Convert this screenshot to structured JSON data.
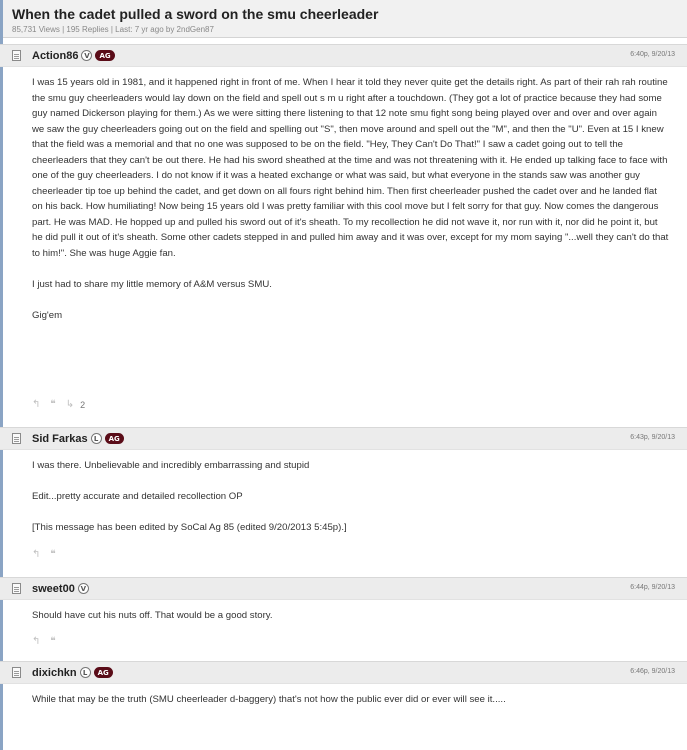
{
  "thread": {
    "title": "When the cadet pulled a sword on the smu cheerleader",
    "meta": "85,731 Views | 195 Replies | Last: 7 yr ago by 2ndGen87"
  },
  "icons": {
    "post": "document-icon",
    "reply": "reply-icon",
    "quote": "quote-icon",
    "like": "like-icon",
    "reply_glyph": "↰",
    "quote_glyph": "❝",
    "like_glyph": "↳"
  },
  "colors": {
    "ag_badge": "#5a0c18",
    "header_bg": "#ececec"
  },
  "posts": [
    {
      "username": "Action86",
      "badge_letter": "V",
      "badge_ag": "AG",
      "time": "6:40p, 9/20/13",
      "paragraphs": [
        "I was 15 years old in 1981, and it happened right in front of me. When I hear it told they never quite get the details right. As part of their rah rah routine the smu guy cheerleaders would lay down on the field and spell out s m u right after a touchdown. (They got a lot of practice because they had some guy named Dickerson playing for them.) As we were sitting there listening to that 12 note smu fight song being played over and over and over again we saw the guy cheerleaders going out on the field and spelling out \"S\", then move around and spell out the \"M\", and then the \"U\". Even at 15 I knew that the field was a memorial and that no one was supposed to be on the field. \"Hey, They Can't Do That!\" I saw a cadet going out to tell the cheerleaders that they can't be out there. He had his sword sheathed at the time and was not threatening with it. He ended up talking face to face with one of the guy cheerleaders. I do not know if it was a heated exchange or what was said, but what everyone in the stands saw was another guy cheerleader tip toe up behind the cadet, and get down on all fours right behind him. Then first cheerleader pushed the cadet over and he landed flat on his back. How humiliating! Now being 15 years old I was pretty familiar with this cool move but I felt sorry for that guy. Now comes the dangerous part. He was MAD. He hopped up and pulled his sword out of it's sheath. To my recollection he did not wave it, nor run with it, nor did he point it, but he did pull it out of it's sheath. Some other cadets stepped in and pulled him away and it was over, except for my mom saying \"...well they can't do that to him!\". She was huge Aggie fan.",
        "I just had to share my little memory of A&M versus SMU.",
        "Gig'em"
      ],
      "like_count": "2"
    },
    {
      "username": "Sid Farkas",
      "badge_letter": "L",
      "badge_ag": "AG",
      "time": "6:43p, 9/20/13",
      "paragraphs": [
        "I was there. Unbelievable and incredibly embarrassing and stupid",
        "Edit...pretty accurate and detailed recollection OP",
        "[This message has been edited by SoCal Ag 85 (edited 9/20/2013 5:45p).]"
      ]
    },
    {
      "username": "sweet00",
      "badge_letter": "V",
      "time": "6:44p, 9/20/13",
      "paragraphs": [
        "Should have cut his nuts off. That would be a good story."
      ]
    },
    {
      "username": "dixichkn",
      "badge_letter": "L",
      "badge_ag": "AG",
      "time": "6:46p, 9/20/13",
      "paragraphs": [
        "While that may be the truth (SMU cheerleader d-baggery) that's not how the public ever did or ever will see it....."
      ]
    }
  ]
}
